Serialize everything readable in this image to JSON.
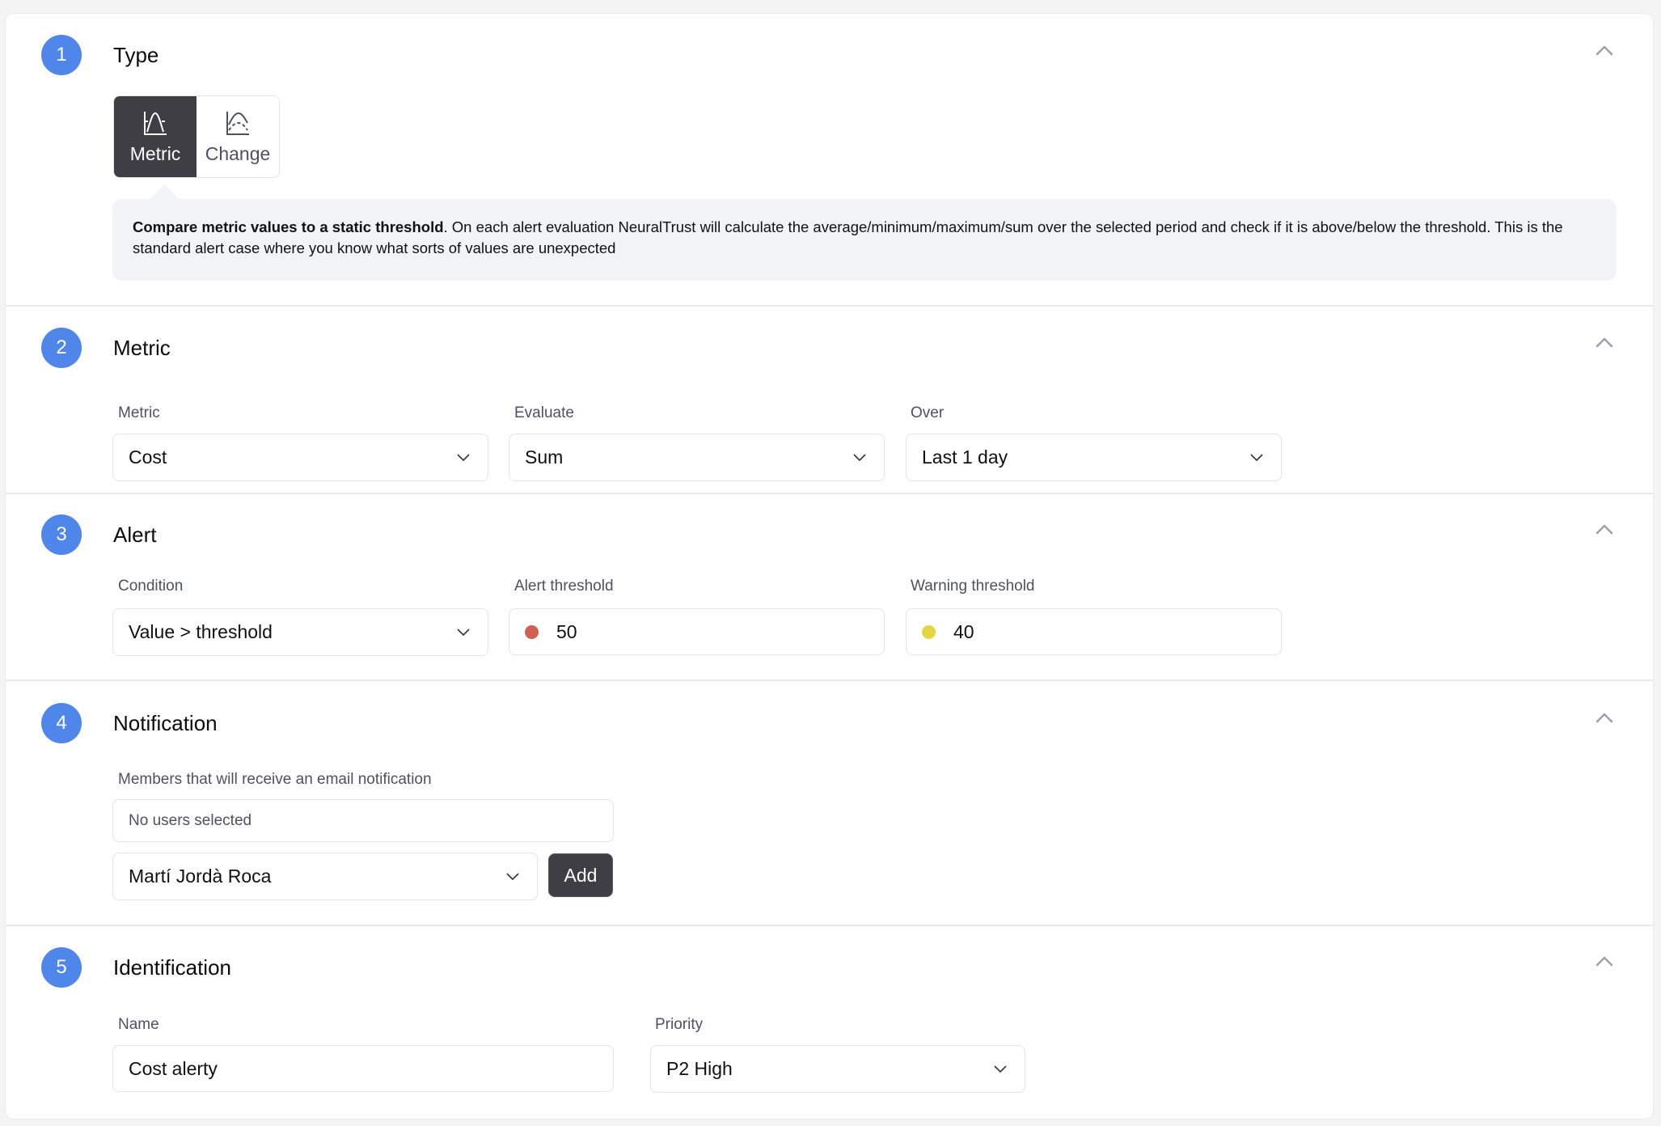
{
  "sections": {
    "type": {
      "step": "1",
      "title": "Type",
      "options": [
        {
          "label": "Metric",
          "icon": "metric-chart-icon",
          "selected": true
        },
        {
          "label": "Change",
          "icon": "change-chart-icon",
          "selected": false
        }
      ],
      "info_bold": "Compare metric values to a static threshold",
      "info_text": ". On each alert evaluation NeuralTrust will calculate the average/minimum/maximum/sum over the selected period and check if it is above/below the threshold. This is the standard alert case where you know what sorts of values are unexpected"
    },
    "metric": {
      "step": "2",
      "title": "Metric",
      "fields": [
        {
          "label": "Metric",
          "value": "Cost"
        },
        {
          "label": "Evaluate",
          "value": "Sum"
        },
        {
          "label": "Over",
          "value": "Last 1 day"
        }
      ]
    },
    "alert": {
      "step": "3",
      "title": "Alert",
      "condition": {
        "label": "Condition",
        "value": "Value > threshold"
      },
      "alert_threshold": {
        "label": "Alert threshold",
        "value": "50",
        "color": "#d15f52"
      },
      "warning_threshold": {
        "label": "Warning threshold",
        "value": "40",
        "color": "#e5d544"
      }
    },
    "notification": {
      "step": "4",
      "title": "Notification",
      "members_label": "Members that will receive an email notification",
      "members_empty": "No users selected",
      "member_select": "Martí Jordà Roca",
      "add_label": "Add"
    },
    "identification": {
      "step": "5",
      "title": "Identification",
      "name": {
        "label": "Name",
        "value": "Cost alerty"
      },
      "priority": {
        "label": "Priority",
        "value": "P2 High"
      }
    }
  },
  "colors": {
    "step_circle": "#4f86ea",
    "active_segment": "#3f3e45",
    "chevron": "#9aa1ae"
  }
}
